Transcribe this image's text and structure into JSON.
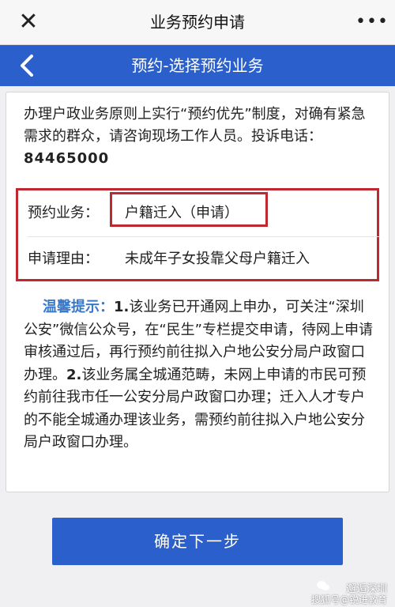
{
  "topbar": {
    "title": "业务预约申请",
    "close_icon": "close-icon",
    "more_icon": "more-icon"
  },
  "header": {
    "title": "预约-选择预约业务",
    "back_icon": "chevron-left-icon",
    "color": "#2b5fcb"
  },
  "notice": {
    "text": "办理户政业务原则上实行“预约优先”制度，对确有紧急需求的群众，请咨询现场工作人员。投诉电话：",
    "phone": "84465000"
  },
  "business": {
    "label": "预约业务：",
    "value": "户籍迁入（申请）",
    "reason_label": "申请理由：",
    "reason_value": "未成年子女投靠父母户籍迁入"
  },
  "tips": {
    "label": "温馨提示：",
    "p1_num": "1.",
    "p1": "该业务已开通网上申办，可关注“深圳公安”微信公众号，在“民生”专栏提交申请，待网上申请审核通过后，再行预约前往拟入户地公安分局户政窗口办理。",
    "p2_num": "2.",
    "p2": "该业务属全城通范畴，未网上申请的市民可预约前往我市任一公安分局户政窗口办理；迁入人才专户的不能全城通办理该业务，需预约前往拟入户地公安分局户政窗口办理。"
  },
  "button": {
    "label": "确定下一步"
  },
  "watermark": {
    "line1": "邂逅深圳",
    "line2": "搜狐号@锐进教育"
  },
  "colors": {
    "accent": "#2b5fcb",
    "highlight_border": "#c0282f",
    "tips_label": "#3a78c9"
  }
}
